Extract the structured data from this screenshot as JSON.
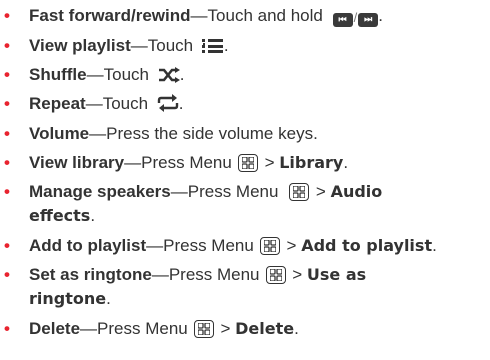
{
  "dash": "—",
  "gt": " > ",
  "period": ".",
  "items": [
    {
      "term": "Fast forward/rewind",
      "text": "Touch and hold",
      "icon": "rewind-forward-buttons-icon",
      "icon_text_a": "⏮",
      "icon_text_b": "⏭",
      "slash": "/"
    },
    {
      "term": "View playlist",
      "text": "Touch",
      "icon": "playlist-icon"
    },
    {
      "term": "Shuffle",
      "text": "Touch",
      "icon": "shuffle-icon"
    },
    {
      "term": "Repeat",
      "text": "Touch",
      "icon": "repeat-icon"
    },
    {
      "term": "Volume",
      "text": "Press the side volume keys."
    },
    {
      "term": "View library",
      "text": "Press Menu",
      "icon": "menu-key-icon",
      "target": "Library"
    },
    {
      "term": "Manage speakers",
      "text": "Press Menu",
      "icon": "menu-key-icon",
      "target_a": "Audio",
      "target_b": "effects"
    },
    {
      "term": "Add to playlist",
      "text": "Press Menu",
      "icon": "menu-key-icon",
      "target": "Add to playlist"
    },
    {
      "term": "Set as ringtone",
      "text": "Press Menu",
      "icon": "menu-key-icon",
      "target_a": "Use as",
      "target_b": "ringtone"
    },
    {
      "term": "Delete",
      "text": "Press Menu",
      "icon": "menu-key-icon",
      "target": "Delete"
    }
  ],
  "colors": {
    "bullet": "#e8232f",
    "text": "#333333"
  }
}
